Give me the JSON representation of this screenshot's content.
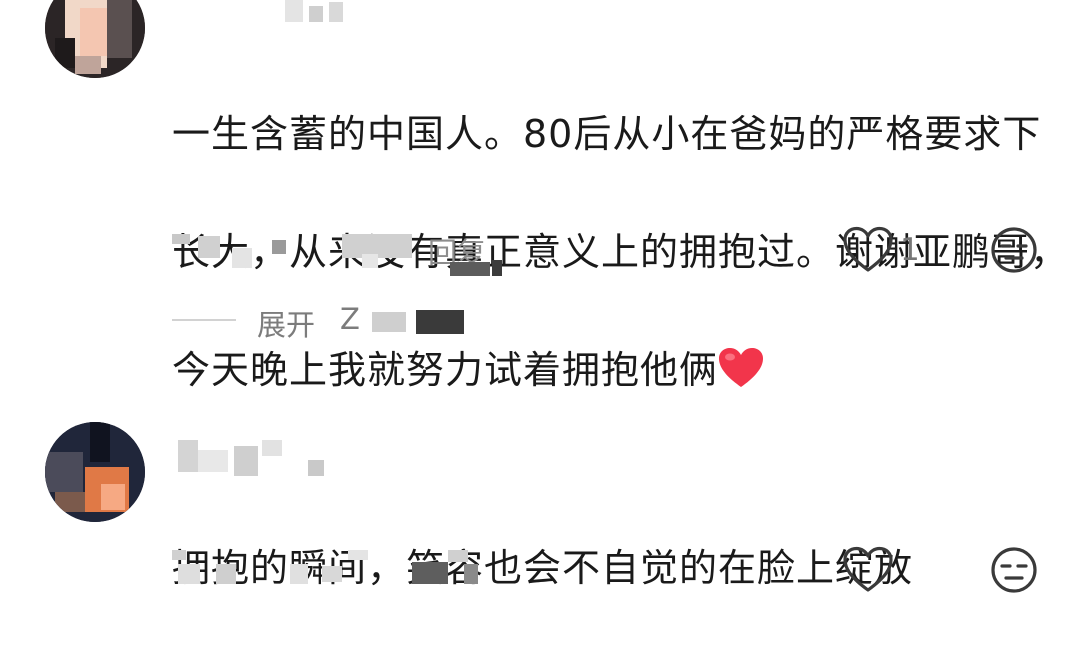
{
  "comments": [
    {
      "text_lines": [
        "一生含蓄的中国人。80后从小在爸妈的严格要求下",
        "长大，从来没有真正意义上的拥抱过。谢谢亚鹏哥，",
        "今天晚上我就努力试着拥抱他俩"
      ],
      "inline_emoji": "red-heart",
      "reply_label": "回复",
      "like_count": "1",
      "expand_label": "展开",
      "expand_tail": "Z"
    },
    {
      "text_lines": [
        "拥抱的瞬间，笑容也会不自觉的在脸上绽放"
      ],
      "like_count": ""
    }
  ],
  "icons": {
    "like": "heart-outline-icon",
    "react": "neutral-face-icon",
    "inline": "red-heart-emoji"
  },
  "colors": {
    "text": "#1a1a1a",
    "meta": "#8d8d8d",
    "heart": "#f2354b"
  }
}
